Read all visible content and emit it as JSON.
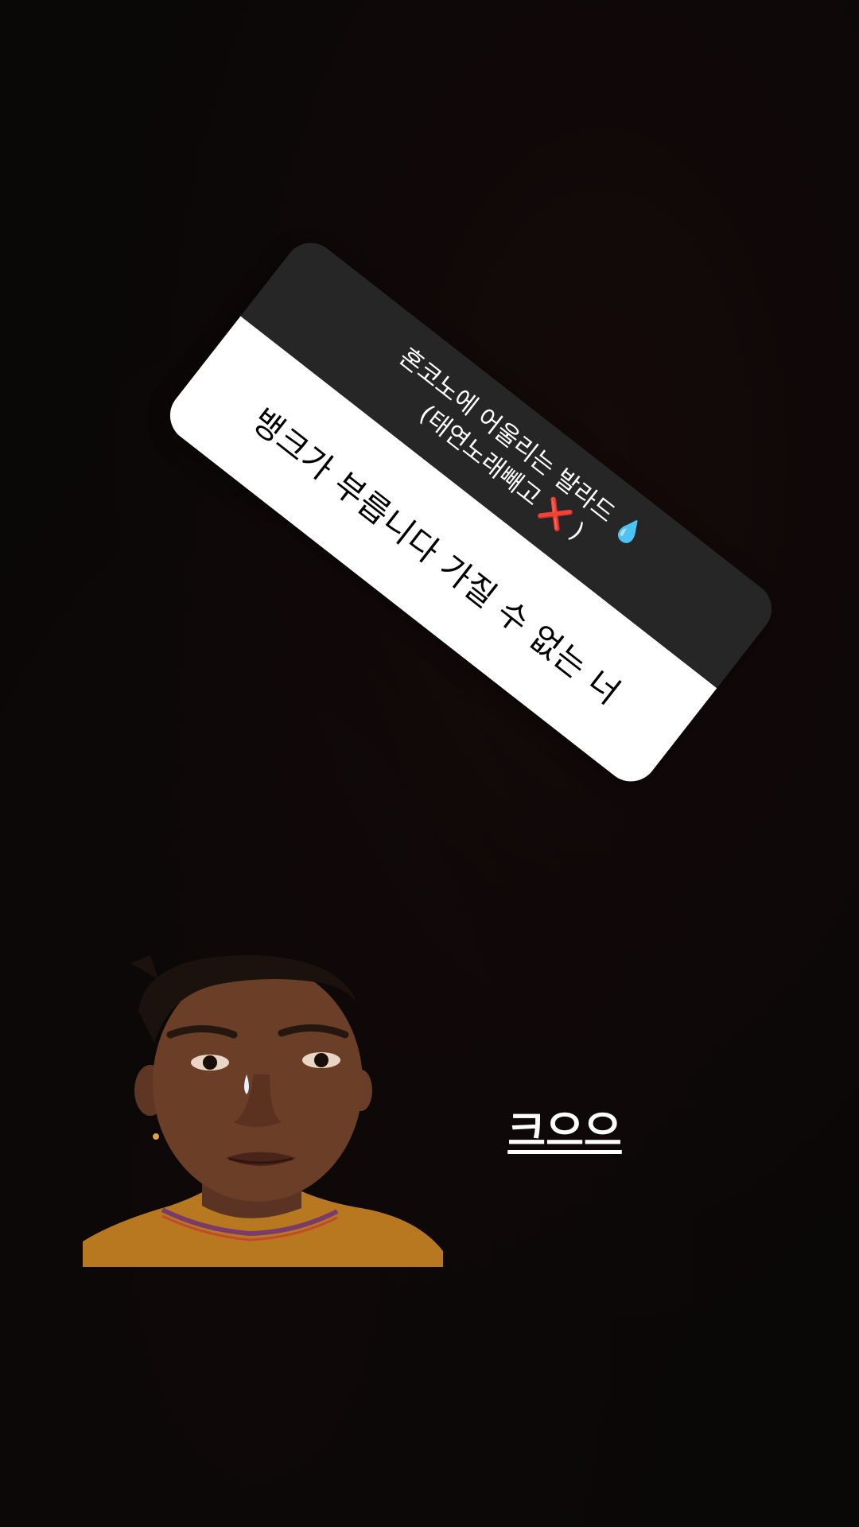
{
  "question_sticker": {
    "question_line_1": "혼코노에 어울리는 발라드",
    "question_line_1_emoji": "💧",
    "question_line_2": "(태연노래빼고",
    "question_line_2_emoji": "❌",
    "question_line_2_end": ")",
    "answer": "뱅크가 부릅니다 가질 수 없는 너",
    "colors": {
      "header_bg": "#262626",
      "answer_bg": "#ffffff"
    }
  },
  "photo_sticker": {
    "icon": "crying-man-photo"
  },
  "caption": {
    "text": "크으으"
  }
}
